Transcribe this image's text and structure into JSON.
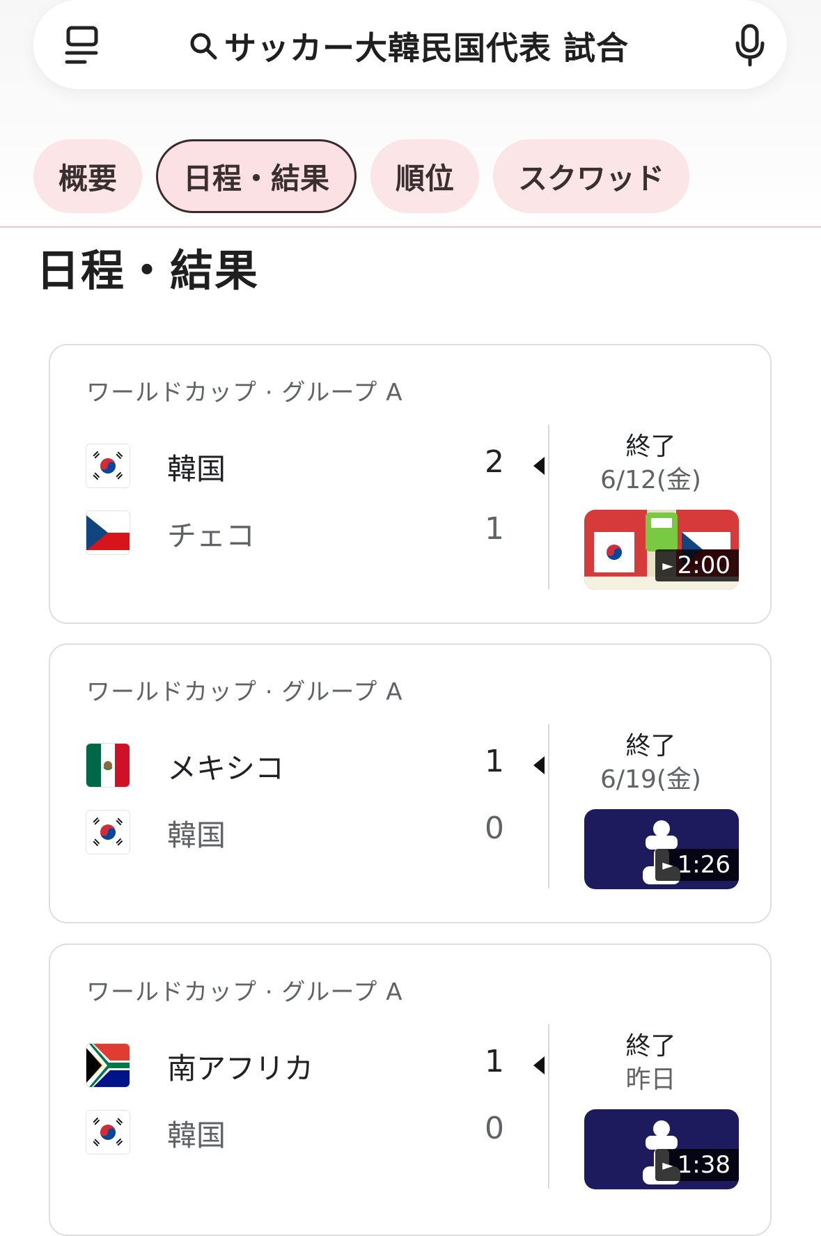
{
  "search": {
    "query": "サッカー大韓民国代表 試合"
  },
  "tabs": [
    {
      "label": "概要"
    },
    {
      "label": "日程・結果"
    },
    {
      "label": "順位"
    },
    {
      "label": "スクワッド"
    }
  ],
  "section_title": "日程・結果",
  "matches": [
    {
      "league": "ワールドカップ · グループ A",
      "home": {
        "name": "韓国",
        "score": "2",
        "flag": "korea-flag"
      },
      "away": {
        "name": "チェコ",
        "score": "1",
        "flag": "czech-flag"
      },
      "status": "終了",
      "date": "6/12(金)",
      "video_duration": "2:00"
    },
    {
      "league": "ワールドカップ · グループ A",
      "home": {
        "name": "メキシコ",
        "score": "1",
        "flag": "mexico-flag"
      },
      "away": {
        "name": "韓国",
        "score": "0",
        "flag": "korea-flag"
      },
      "status": "終了",
      "date": "6/19(金)",
      "video_duration": "1:26"
    },
    {
      "league": "ワールドカップ · グループ A",
      "home": {
        "name": "南アフリカ",
        "score": "1",
        "flag": "south-africa-flag"
      },
      "away": {
        "name": "韓国",
        "score": "0",
        "flag": "korea-flag"
      },
      "status": "終了",
      "date": "昨日",
      "video_duration": "1:38"
    }
  ],
  "colors": {
    "tab_bg": "#fbe5e6",
    "thumb_navy": "#1e1a5e"
  }
}
